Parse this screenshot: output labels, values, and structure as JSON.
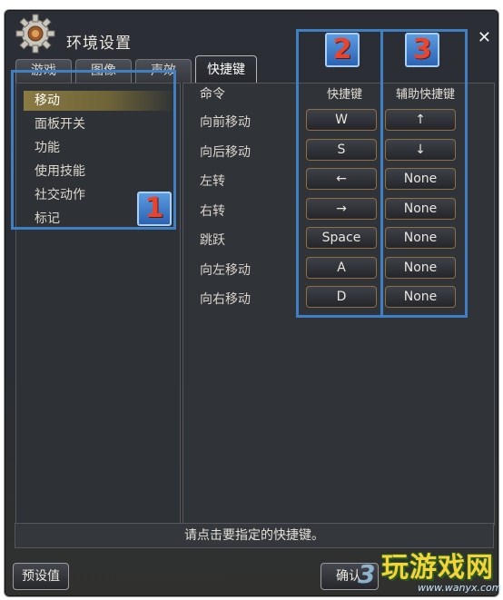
{
  "window": {
    "title": "环境设置",
    "close_glyph": "✕"
  },
  "tabs": [
    {
      "label": "游戏",
      "active": false
    },
    {
      "label": "图像",
      "active": false
    },
    {
      "label": "声效",
      "active": false
    },
    {
      "label": "快捷键",
      "active": true
    }
  ],
  "categories": [
    {
      "label": "移动",
      "selected": true
    },
    {
      "label": "面板开关",
      "selected": false
    },
    {
      "label": "功能",
      "selected": false
    },
    {
      "label": "使用技能",
      "selected": false
    },
    {
      "label": "社交动作",
      "selected": false
    },
    {
      "label": "标记",
      "selected": false
    }
  ],
  "table": {
    "headers": {
      "command": "命令",
      "hotkey": "快捷键",
      "aux_hotkey": "辅助快捷键"
    },
    "rows": [
      {
        "command": "向前移动",
        "hotkey": "W",
        "aux": "↑"
      },
      {
        "command": "向后移动",
        "hotkey": "S",
        "aux": "↓"
      },
      {
        "command": "左转",
        "hotkey": "←",
        "aux": "None"
      },
      {
        "command": "右转",
        "hotkey": "→",
        "aux": "None"
      },
      {
        "command": "跳跃",
        "hotkey": "Space",
        "aux": "None"
      },
      {
        "command": "向左移动",
        "hotkey": "A",
        "aux": "None"
      },
      {
        "command": "向右移动",
        "hotkey": "D",
        "aux": "None"
      }
    ]
  },
  "annotations": [
    "1",
    "2",
    "3"
  ],
  "status": "请点击要指定的快捷键。",
  "buttons": {
    "defaults": "预设值",
    "confirm": "确认"
  },
  "watermark": {
    "site_name": "玩游戏网",
    "url": "www.wanyx.com",
    "number": "3"
  },
  "colors": {
    "annotation_blue": "#3f7fc4",
    "badge_digit_red": "#e8452f",
    "selected_gold": "#8a7a43"
  }
}
